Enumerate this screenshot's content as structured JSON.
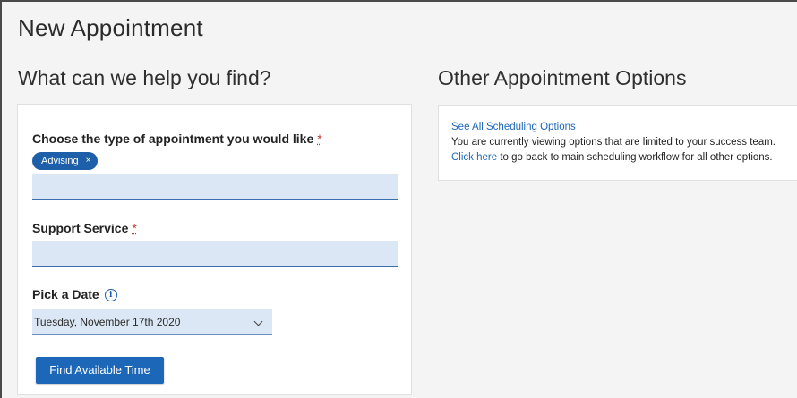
{
  "page": {
    "title": "New Appointment"
  },
  "left": {
    "heading": "What can we help you find?",
    "type_label": "Choose the type of appointment you would like",
    "required_mark": "*",
    "selected_chip": "Advising",
    "chip_remove": "×",
    "service_label": "Support Service",
    "date_label": "Pick a Date",
    "info_glyph": "i",
    "date_value": "Tuesday, November 17th 2020",
    "find_button": "Find Available Time"
  },
  "right": {
    "heading": "Other Appointment Options",
    "see_all_link": "See All Scheduling Options",
    "limited_text": "You are currently viewing options that are limited to your success team.",
    "click_here_link": "Click here",
    "click_here_suffix": " to go back to main scheduling workflow for all other options."
  },
  "colors": {
    "accent": "#1d67b8",
    "chip": "#1d5fa8",
    "field_bg": "#dce7f5",
    "required": "#c0392b",
    "background": "#f4f4f4"
  },
  "icons": {
    "info": "info-circle-icon",
    "chevron": "chevron-down-icon",
    "chip_remove": "close-icon"
  }
}
